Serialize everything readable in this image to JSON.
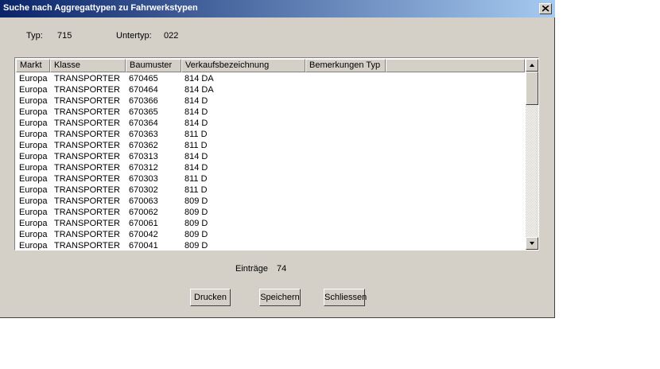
{
  "window": {
    "title": "Suche nach Aggregattypen zu Fahrwerkstypen"
  },
  "info": {
    "typ_label": "Typ:",
    "typ_value": "715",
    "untertyp_label": "Untertyp:",
    "untertyp_value": "022"
  },
  "table": {
    "columns": [
      "Markt",
      "Klasse",
      "Baumuster",
      "Verkaufsbezeichnung",
      "Bemerkungen Typ"
    ],
    "rows": [
      [
        "Europa",
        "TRANSPORTER",
        "670465",
        "814 DA",
        ""
      ],
      [
        "Europa",
        "TRANSPORTER",
        "670464",
        "814 DA",
        ""
      ],
      [
        "Europa",
        "TRANSPORTER",
        "670366",
        "814 D",
        ""
      ],
      [
        "Europa",
        "TRANSPORTER",
        "670365",
        "814 D",
        ""
      ],
      [
        "Europa",
        "TRANSPORTER",
        "670364",
        "814 D",
        ""
      ],
      [
        "Europa",
        "TRANSPORTER",
        "670363",
        "811 D",
        ""
      ],
      [
        "Europa",
        "TRANSPORTER",
        "670362",
        "811 D",
        ""
      ],
      [
        "Europa",
        "TRANSPORTER",
        "670313",
        "814 D",
        ""
      ],
      [
        "Europa",
        "TRANSPORTER",
        "670312",
        "814 D",
        ""
      ],
      [
        "Europa",
        "TRANSPORTER",
        "670303",
        "811 D",
        ""
      ],
      [
        "Europa",
        "TRANSPORTER",
        "670302",
        "811 D",
        ""
      ],
      [
        "Europa",
        "TRANSPORTER",
        "670063",
        "809 D",
        ""
      ],
      [
        "Europa",
        "TRANSPORTER",
        "670062",
        "809 D",
        ""
      ],
      [
        "Europa",
        "TRANSPORTER",
        "670061",
        "809 D",
        ""
      ],
      [
        "Europa",
        "TRANSPORTER",
        "670042",
        "809 D",
        ""
      ],
      [
        "Europa",
        "TRANSPORTER",
        "670041",
        "809 D",
        ""
      ]
    ]
  },
  "footer": {
    "eintraege_label": "Einträge",
    "eintraege_value": "74"
  },
  "buttons": {
    "drucken": "Drucken",
    "speichern": "Speichern",
    "schliessen": "Schliessen"
  },
  "icons": {
    "close": "close-icon",
    "scroll_up": "arrow-up-icon",
    "scroll_down": "arrow-down-icon"
  }
}
